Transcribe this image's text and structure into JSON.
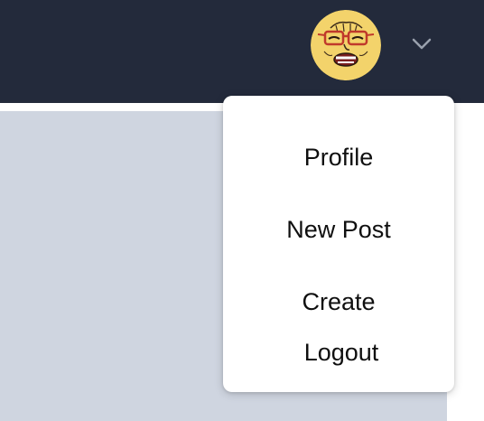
{
  "header": {
    "background_color": "#232a3b",
    "avatar_icon": "user-avatar-cartoon-face-with-red-glasses",
    "dropdown_toggle_icon": "chevron-down-icon"
  },
  "main": {
    "background_color": "#cfd5e0"
  },
  "dropdown_menu": {
    "items": [
      {
        "label": "Profile"
      },
      {
        "label": "New Post"
      },
      {
        "label": "Create"
      },
      {
        "label": "Logout"
      }
    ]
  }
}
